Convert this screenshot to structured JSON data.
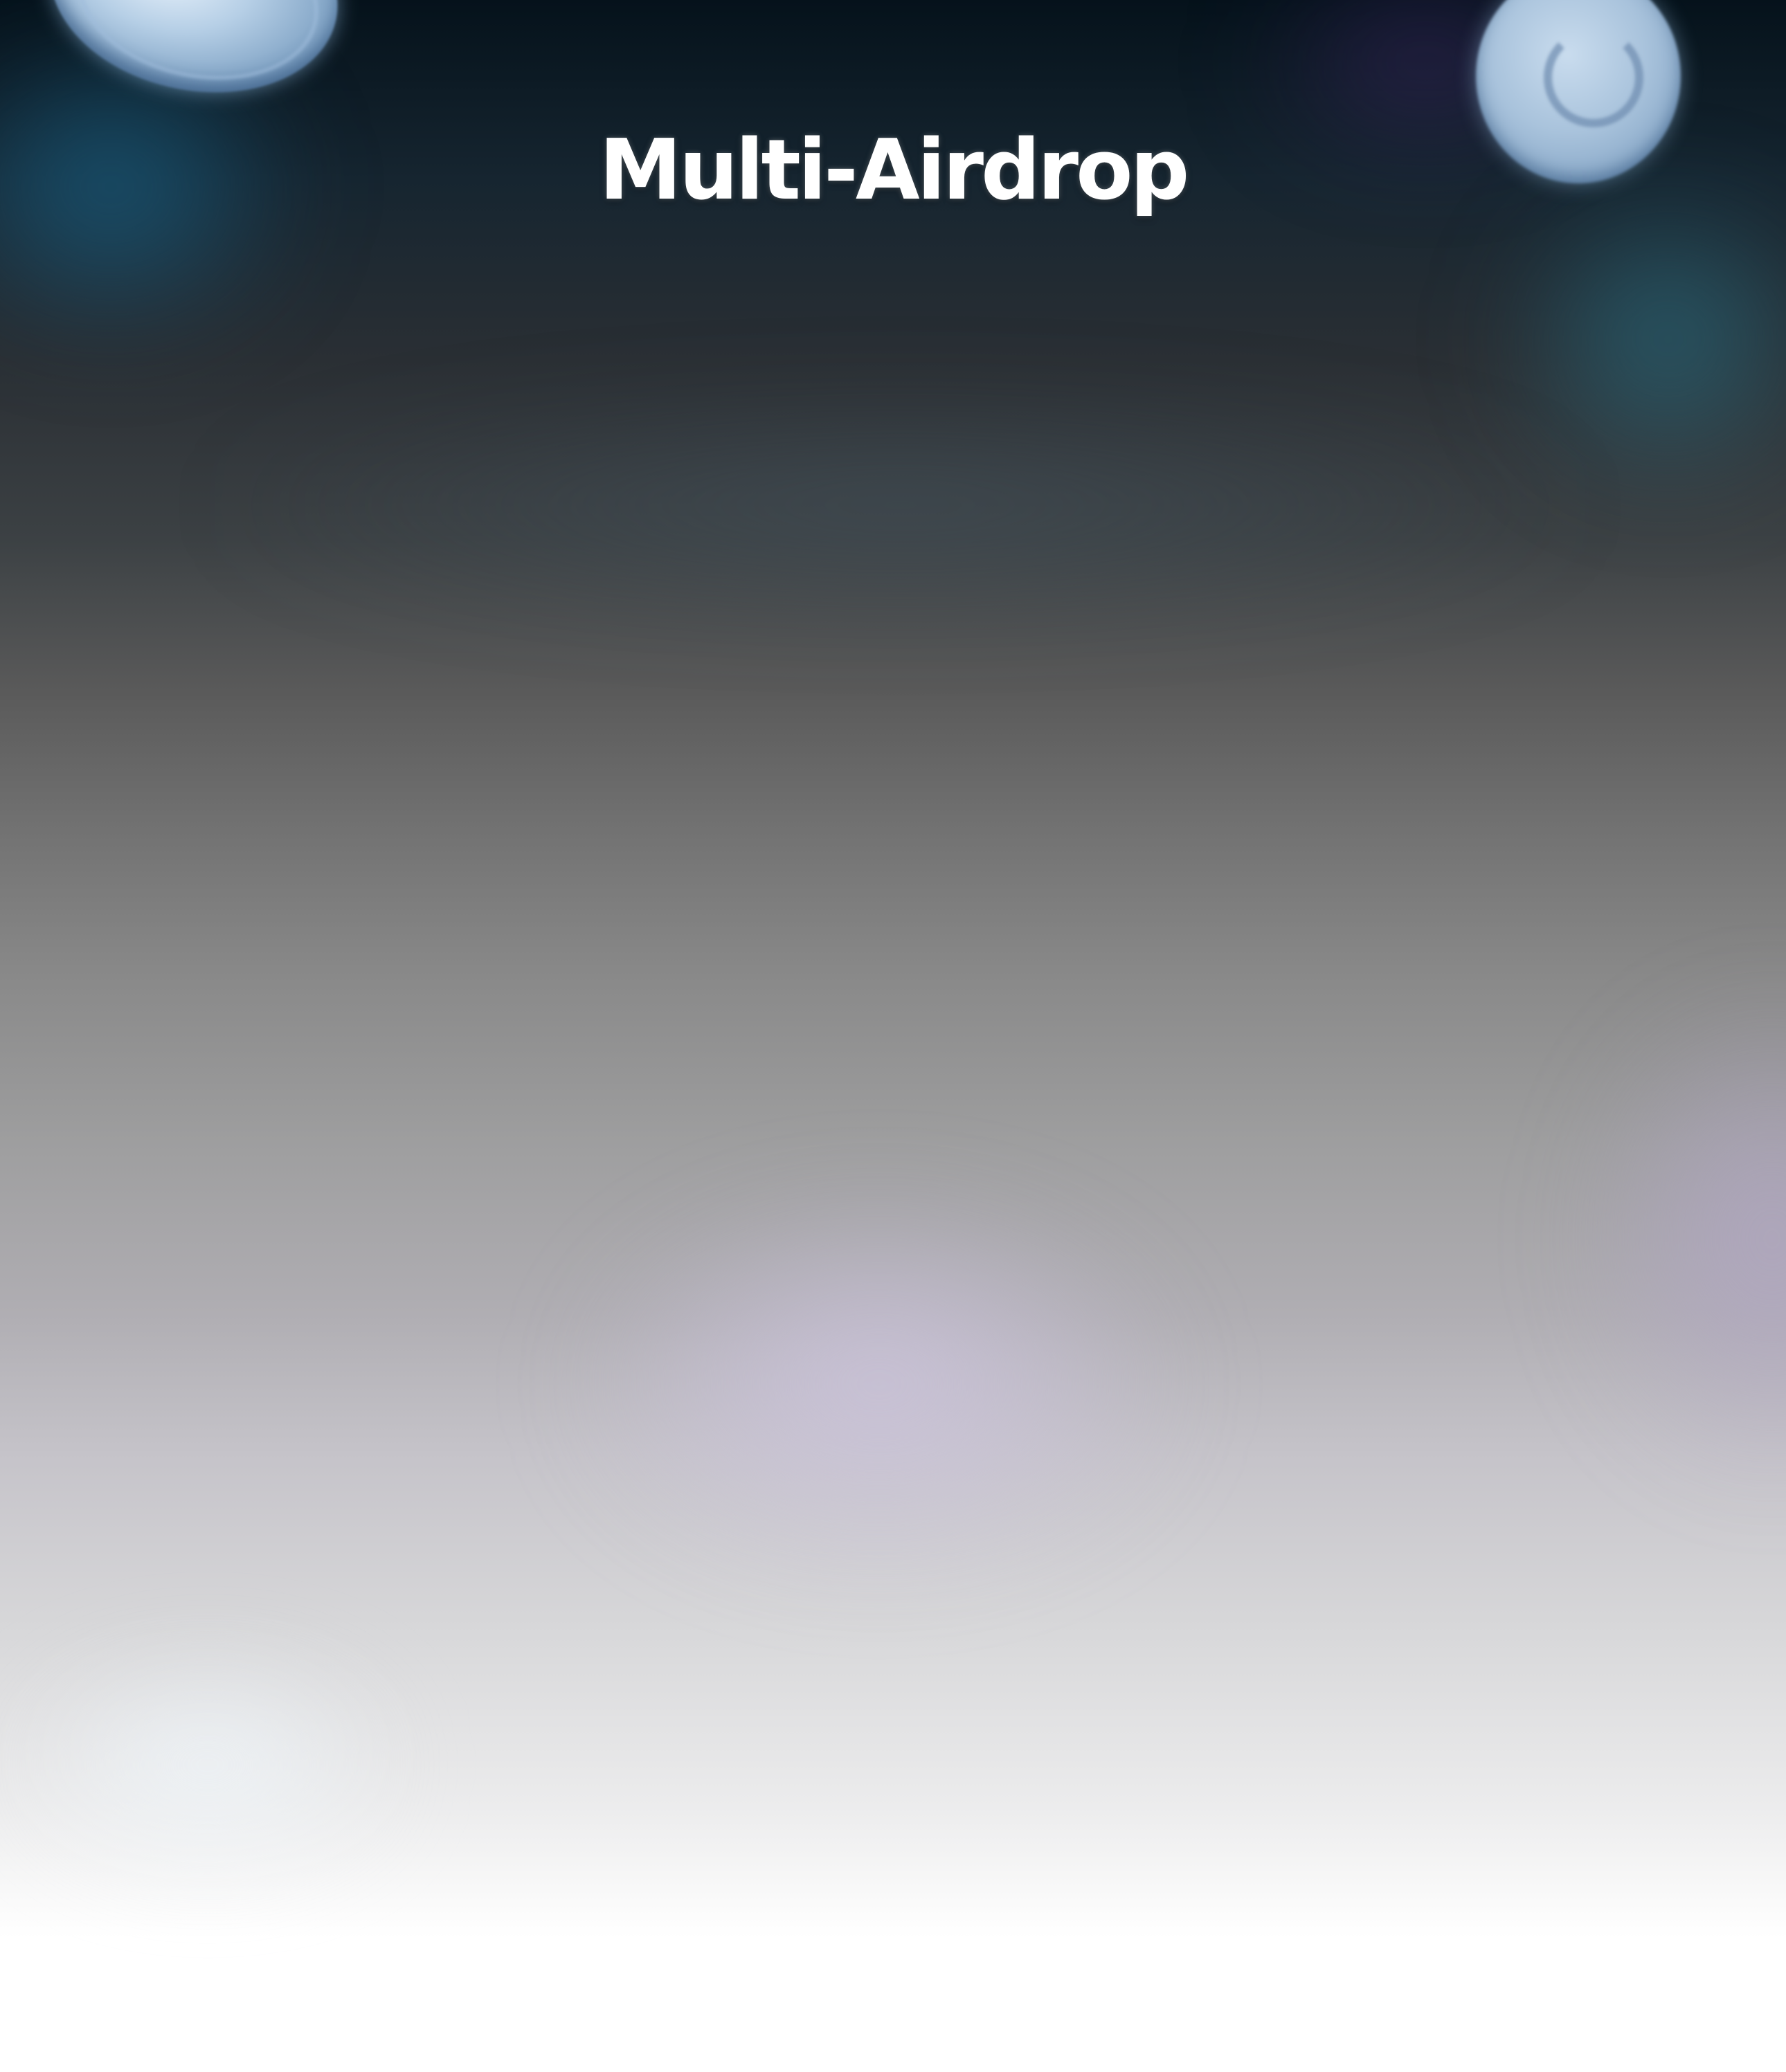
{
  "page": {
    "title": "Multi-Airdrop"
  },
  "theme": {
    "title_color": "#ffffff",
    "top_color": "#05121b",
    "bottom_color": "#ffffff",
    "glow_blue": "#195f82",
    "glow_lavender": "#cdc4de"
  },
  "decorations": {
    "left_icon": "coin-icon",
    "right_icon": "coin-icon"
  }
}
